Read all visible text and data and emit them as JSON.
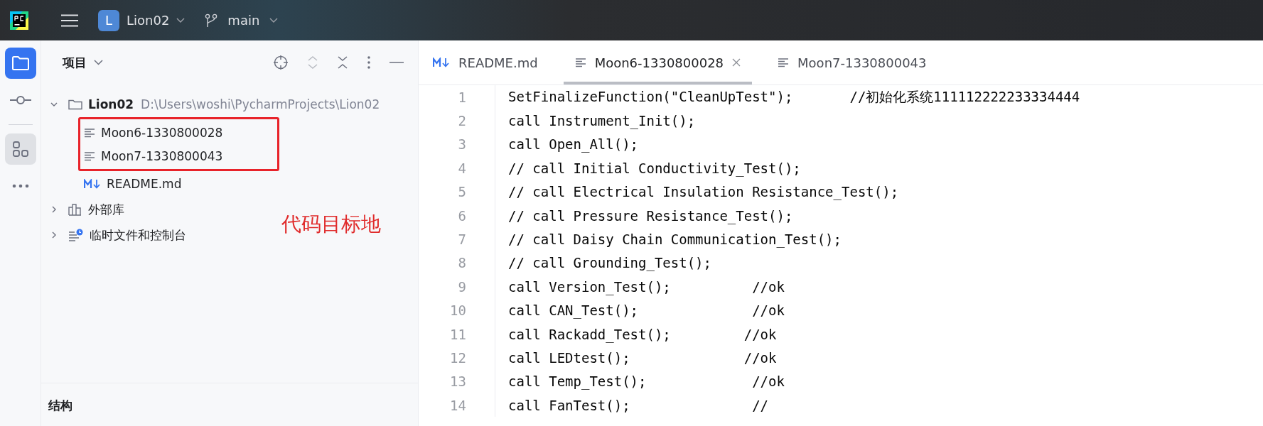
{
  "top_bar": {
    "project_initial": "L",
    "project": "Lion02",
    "branch": "main"
  },
  "tool_strip": [
    {
      "kind": "folder",
      "selected": true,
      "highlighted": false
    },
    {
      "kind": "commit",
      "selected": false,
      "highlighted": false
    },
    {
      "kind": "structure",
      "selected": false,
      "highlighted": true
    },
    {
      "kind": "more",
      "selected": false,
      "highlighted": false
    }
  ],
  "project_panel": {
    "title": "项目",
    "tree": [
      {
        "kind": "folder",
        "name": "Lion02",
        "path": "D:\\Users\\woshi\\PycharmProjects\\Lion02",
        "expanded": true,
        "children": [
          {
            "kind": "text",
            "name": "Moon6-1330800028",
            "annotated": true
          },
          {
            "kind": "text",
            "name": "Moon7-1330800043",
            "annotated": true
          },
          {
            "kind": "markdown",
            "name": "README.md",
            "annotated": false
          }
        ]
      },
      {
        "kind": "library",
        "name": "外部库",
        "expanded": false
      },
      {
        "kind": "scratch",
        "name": "临时文件和控制台",
        "expanded": false
      }
    ],
    "annotation": "代码目标地"
  },
  "structure_panel": {
    "title": "结构"
  },
  "editor": {
    "tabs": [
      {
        "kind": "markdown",
        "label": "README.md",
        "selected": false
      },
      {
        "kind": "text",
        "label": "Moon6-1330800028",
        "selected": true
      },
      {
        "kind": "text",
        "label": "Moon7-1330800043",
        "selected": false
      }
    ],
    "lines": [
      {
        "number": "1",
        "text": "SetFinalizeFunction(\"CleanUpTest\");       //初始化系统111112222233334444"
      },
      {
        "number": "2",
        "text": "call Instrument_Init();"
      },
      {
        "number": "3",
        "text": "call Open_All();"
      },
      {
        "number": "4",
        "text": "// call Initial Conductivity_Test();"
      },
      {
        "number": "5",
        "text": "// call Electrical Insulation Resistance_Test();"
      },
      {
        "number": "6",
        "text": "// call Pressure Resistance_Test();"
      },
      {
        "number": "7",
        "text": "// call Daisy Chain Communication_Test();"
      },
      {
        "number": "8",
        "text": "// call Grounding_Test();"
      },
      {
        "number": "9",
        "text": "call Version_Test();          //ok"
      },
      {
        "number": "10",
        "text": "call CAN_Test();              //ok"
      },
      {
        "number": "11",
        "text": "call Rackadd_Test();         //ok"
      },
      {
        "number": "12",
        "text": "call LEDtest();              //ok"
      },
      {
        "number": "13",
        "text": "call Temp_Test();             //ok"
      },
      {
        "number": "14",
        "text": "call FanTest();               //"
      }
    ]
  }
}
